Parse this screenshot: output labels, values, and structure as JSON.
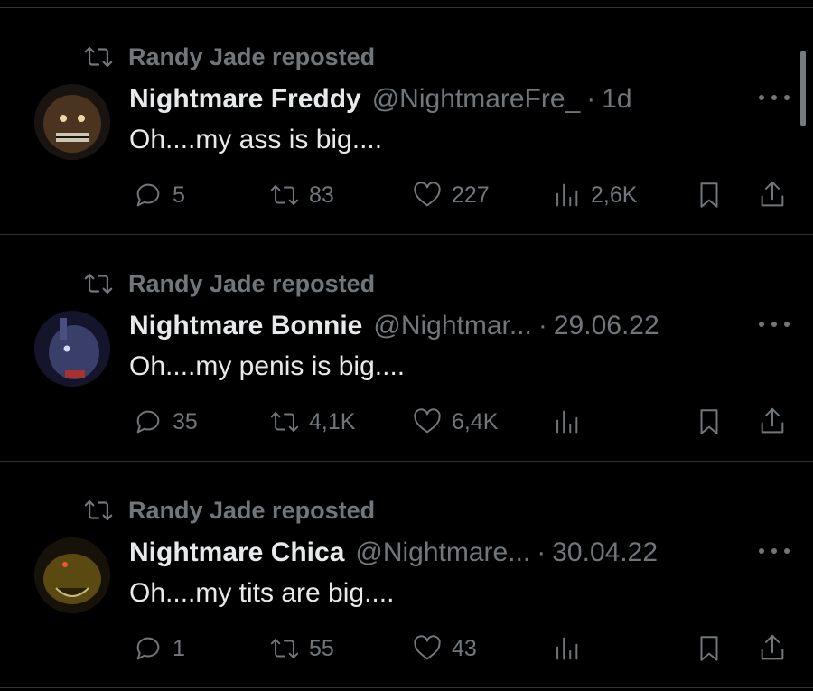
{
  "posts": [
    {
      "repost_label": "Randy Jade reposted",
      "author_name": "Nightmare Freddy",
      "handle": "@NightmareFre_",
      "separator": "·",
      "date": "1d",
      "text": "Oh....my ass is big....",
      "replies": "5",
      "reposts": "83",
      "likes": "227",
      "views": "2,6K",
      "avatar_color": "#4a3420"
    },
    {
      "repost_label": "Randy Jade reposted",
      "author_name": "Nightmare Bonnie",
      "handle": "@Nightmar...",
      "separator": "·",
      "date": "29.06.22",
      "text": "Oh....my penis is big....",
      "replies": "35",
      "reposts": "4,1K",
      "likes": "6,4K",
      "views": "",
      "avatar_color": "#3a3f6a"
    },
    {
      "repost_label": "Randy Jade reposted",
      "author_name": "Nightmare Chica",
      "handle": "@Nightmare...",
      "separator": "·",
      "date": "30.04.22",
      "text": "Oh....my tits are big....",
      "replies": "1",
      "reposts": "55",
      "likes": "43",
      "views": "",
      "avatar_color": "#5a4a12"
    }
  ],
  "colors": {
    "background": "#000000",
    "primary_text": "#e7e9ea",
    "secondary_text": "#71767b",
    "divider": "#2f3336"
  }
}
